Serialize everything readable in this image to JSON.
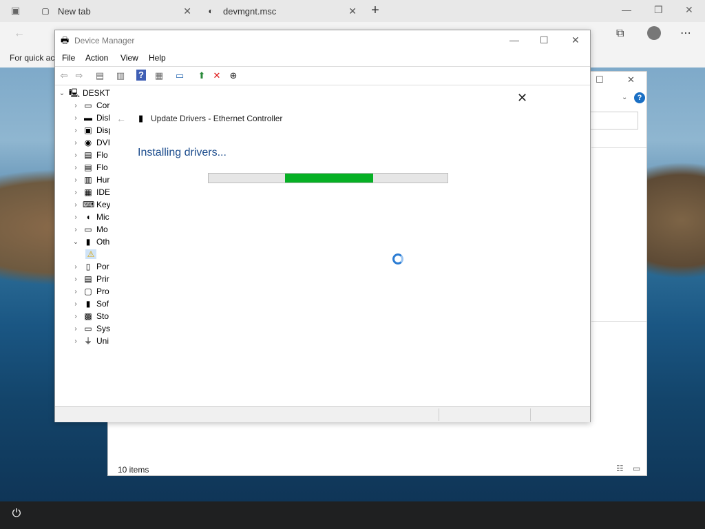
{
  "browser": {
    "tabs": [
      {
        "label": "New tab"
      },
      {
        "label": "devmgnt.msc"
      }
    ],
    "quick_access_text": "For quick ac",
    "new_tab_symbol": "+"
  },
  "explorer": {
    "status": "10 items"
  },
  "device_manager": {
    "title": "Device Manager",
    "menu": [
      "File",
      "Action",
      "View",
      "Help"
    ],
    "tree": [
      {
        "label": "DESKTO",
        "icon": "computer-icon",
        "expanded": true
      },
      {
        "label": "Cor",
        "icon": "monitor-icon"
      },
      {
        "label": "Disl",
        "icon": "disk-icon"
      },
      {
        "label": "Disp",
        "icon": "display-adapter-icon"
      },
      {
        "label": "DVI",
        "icon": "dvd-icon"
      },
      {
        "label": "Flo",
        "icon": "floppy-icon"
      },
      {
        "label": "Flo",
        "icon": "floppy-icon"
      },
      {
        "label": "Hur",
        "icon": "hid-icon"
      },
      {
        "label": "IDE",
        "icon": "ide-icon"
      },
      {
        "label": "Key",
        "icon": "keyboard-icon"
      },
      {
        "label": "Mic",
        "icon": "mouse-icon"
      },
      {
        "label": "Mo",
        "icon": "monitor-icon"
      },
      {
        "label": "Oth",
        "icon": "unknown-device-icon",
        "expanded": true
      },
      {
        "label": "",
        "icon": "warning-device-icon",
        "child": true
      },
      {
        "label": "Por",
        "icon": "port-icon"
      },
      {
        "label": "Prir",
        "icon": "printer-icon"
      },
      {
        "label": "Pro",
        "icon": "processor-icon"
      },
      {
        "label": "Sof",
        "icon": "software-device-icon"
      },
      {
        "label": "Sto",
        "icon": "storage-icon"
      },
      {
        "label": "Sys",
        "icon": "system-icon"
      },
      {
        "label": "Uni",
        "icon": "usb-icon"
      }
    ]
  },
  "dialog": {
    "title": "Update Drivers - Ethernet Controller",
    "heading": "Installing drivers...",
    "progress": {
      "start": 0.32,
      "end": 0.69
    },
    "progress_color": "#06b025",
    "heading_color": "#1a4b8c"
  }
}
